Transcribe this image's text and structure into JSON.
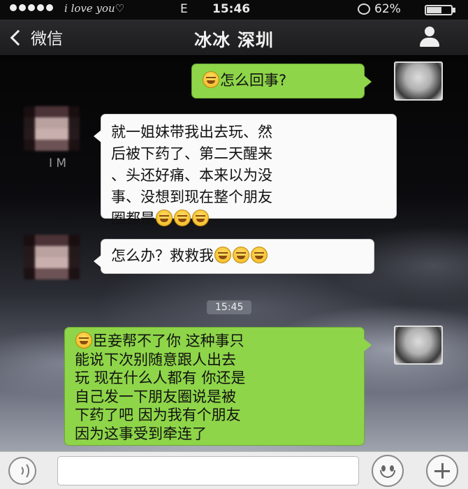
{
  "status_bar": {
    "carrier": "i love you♡",
    "network": "E",
    "time": "15:46",
    "battery": "62%",
    "battery_level": 0.62
  },
  "nav": {
    "back_label": "微信",
    "title": "冰冰 深圳"
  },
  "chat": {
    "stray_text": "I   M",
    "messages": [
      {
        "from": "self",
        "text": "怎么回事?"
      },
      {
        "from": "friend",
        "lines": [
          "就一姐妹带我出去玩、然",
          "后被下药了、第二天醒来",
          "、头还好痛、本来以为没",
          "事、没想到现在整个朋友",
          "圈都是"
        ]
      },
      {
        "from": "friend",
        "text": "怎么办？救救我"
      },
      {
        "from": "self",
        "lines": [
          "臣妾帮不了你 这种事只",
          "能说下次别随意跟人出去",
          "玩 现在什么人都有 你还是",
          "自己发一下朋友圈说是被",
          "下药了吧 因为我有个朋友",
          "因为这事受到牵连了"
        ]
      }
    ],
    "timestamp": "15:45"
  },
  "input_bar": {
    "placeholder": ""
  },
  "icons": {
    "back": "chevron-left-icon",
    "profile": "person-icon",
    "voice": "voice-icon",
    "emoji": "smiley-icon",
    "plus": "plus-icon",
    "emoji_in_text": "laugh-cry-emoji"
  },
  "colors": {
    "outgoing_bubble": "#8ed549",
    "incoming_bubble": "#fafafa",
    "nav_bar": "#1c1c1e"
  }
}
